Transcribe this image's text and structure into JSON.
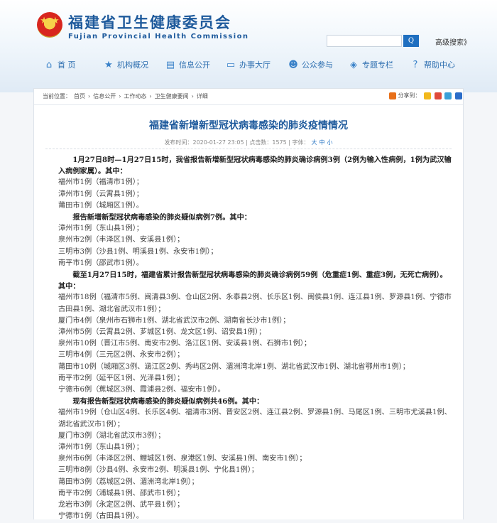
{
  "header": {
    "title_cn": "福建省卫生健康委员会",
    "title_en": "Fujian Provincial Health Commission",
    "search_button": "Q",
    "advanced_search": "高级搜索》"
  },
  "nav": [
    {
      "label": "首  页",
      "icon": "home-icon"
    },
    {
      "label": "机构概况",
      "icon": "star-icon"
    },
    {
      "label": "信息公开",
      "icon": "document-icon"
    },
    {
      "label": "办事大厅",
      "icon": "laptop-icon"
    },
    {
      "label": "公众参与",
      "icon": "people-icon"
    },
    {
      "label": "专题专栏",
      "icon": "topic-icon"
    },
    {
      "label": "帮助中心",
      "icon": "help-icon"
    }
  ],
  "breadcrumb": {
    "prefix": "当前位置：",
    "items": [
      "首页",
      "信息公开",
      "工作动态",
      "卫生健康要闻",
      "详细"
    ],
    "sep": "›"
  },
  "share": {
    "label": "分享到："
  },
  "article": {
    "title": "福建省新增新型冠状病毒感染的肺炎疫情情况",
    "date": "发布时间：2020-01-27 23:05",
    "views": "点击数：1575",
    "font_label": "字体：",
    "font_sizes": [
      "大",
      "中",
      "小"
    ],
    "paragraphs": [
      {
        "type": "b",
        "text": "1月27日8时—1月27日15时，我省报告新增新型冠状病毒感染的肺炎确诊病例3例（2例为输入性病例，1例为武汉输入病例家属）。其中："
      },
      {
        "type": "l",
        "text": "福州市1例（福清市1例）；"
      },
      {
        "type": "l",
        "text": "漳州市1例（云霄县1例）；"
      },
      {
        "type": "l",
        "text": "莆田市1例（城厢区1例）。"
      },
      {
        "type": "b",
        "text": "报告新增新型冠状病毒感染的肺炎疑似病例7例。其中："
      },
      {
        "type": "l",
        "text": "漳州市1例（东山县1例）；"
      },
      {
        "type": "l",
        "text": "泉州市2例（丰泽区1例、安溪县1例）；"
      },
      {
        "type": "l",
        "text": "三明市3例（沙县1例、明溪县1例、永安市1例）；"
      },
      {
        "type": "l",
        "text": "南平市1例（邵武市1例）。"
      },
      {
        "type": "b",
        "text": "截至1月27日15时，福建省累计报告新型冠状病毒感染的肺炎确诊病例59例（危重症1例、重症3例，无死亡病例）。其中："
      },
      {
        "type": "l",
        "text": "福州市18例（福清市5例、闽清县3例、仓山区2例、永泰县2例、长乐区1例、闽侯县1例、连江县1例、罗源县1例、宁德市古田县1例、湖北省武汉市1例）；"
      },
      {
        "type": "l",
        "text": "厦门市4例（泉州市石狮市1例、湖北省武汉市2例、湖南省长沙市1例）；"
      },
      {
        "type": "l",
        "text": "漳州市5例（云霄县2例、芗城区1例、龙文区1例、诏安县1例）；"
      },
      {
        "type": "l",
        "text": "泉州市10例（晋江市5例、南安市2例、洛江区1例、安溪县1例、石狮市1例）；"
      },
      {
        "type": "l",
        "text": "三明市4例（三元区2例、永安市2例）；"
      },
      {
        "type": "l",
        "text": "莆田市10例（城厢区3例、涵江区2例、秀屿区2例、湄洲湾北岸1例、湖北省武汉市1例、湖北省鄂州市1例）；"
      },
      {
        "type": "l",
        "text": "南平市2例（延平区1例、光泽县1例）；"
      },
      {
        "type": "l",
        "text": "宁德市6例（蕉城区3例、霞浦县2例、福安市1例）。"
      },
      {
        "type": "b",
        "text": "现有报告新型冠状病毒感染的肺炎疑似病例共46例。其中："
      },
      {
        "type": "l",
        "text": "福州市19例（仓山区4例、长乐区4例、福清市3例、晋安区2例、连江县2例、罗源县1例、马尾区1例、三明市尤溪县1例、湖北省武汉市1例）；"
      },
      {
        "type": "l",
        "text": "厦门市3例（湖北省武汉市3例）；"
      },
      {
        "type": "l",
        "text": "漳州市1例（东山县1例）；"
      },
      {
        "type": "l",
        "text": "泉州市6例（丰泽区2例、鲤城区1例、泉港区1例、安溪县1例、南安市1例）；"
      },
      {
        "type": "l",
        "text": "三明市8例（沙县4例、永安市2例、明溪县1例、宁化县1例）；"
      },
      {
        "type": "l",
        "text": "莆田市3例（荔城区2例、湄洲湾北岸1例）；"
      },
      {
        "type": "l",
        "text": "南平市2例（浦城县1例、邵武市1例）；"
      },
      {
        "type": "l",
        "text": "龙岩市3例（永定区2例、武平县1例）；"
      },
      {
        "type": "l",
        "text": "宁德市1例（古田县1例）。"
      }
    ]
  }
}
